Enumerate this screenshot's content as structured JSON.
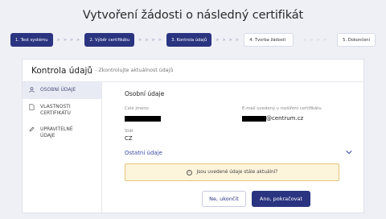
{
  "title": "Vytvoření žádosti o následný certifikát",
  "steps": [
    {
      "label": "1. Test systému",
      "state": "done"
    },
    {
      "label": "2. Výběr certifikátu",
      "state": "done"
    },
    {
      "label": "3. Kontrola údajů",
      "state": "done"
    },
    {
      "label": "4. Tvorba žádosti",
      "state": "todo"
    },
    {
      "label": "5. Dokončení",
      "state": "todo"
    }
  ],
  "step_separator": "> > > >",
  "card": {
    "title": "Kontrola údajů",
    "subtitle": "- Zkontrolujte aktuálnost údajů"
  },
  "sidebar": {
    "items": [
      {
        "label": "OSOBNÍ ÚDAJE",
        "icon": "person-icon",
        "active": true
      },
      {
        "label": "VLASTNOSTI CERTIFIKÁTU",
        "icon": "document-icon",
        "active": false
      },
      {
        "label": "UPRAVITELNÉ ÚDAJE",
        "icon": "pencil-icon",
        "active": false
      }
    ]
  },
  "personal": {
    "section_title": "Osobní údaje",
    "name_label": "Celé jméno",
    "email_label": "E-mail uvedený v rozšíření certifikátu",
    "email_suffix": "@centrum.cz",
    "country_label": "Stát",
    "country_value": "CZ"
  },
  "other_link": "Ostatní údaje",
  "alert_text": "Jsou uvedené údaje stále aktuální?",
  "buttons": {
    "no_label": "Ne, ukončit",
    "yes_label": "Ano, pokračovat"
  },
  "colors": {
    "primary": "#2b3480",
    "alert_bg": "#fdf4dc",
    "alert_border": "#e8c77a",
    "page_bg": "#eef0f6"
  }
}
